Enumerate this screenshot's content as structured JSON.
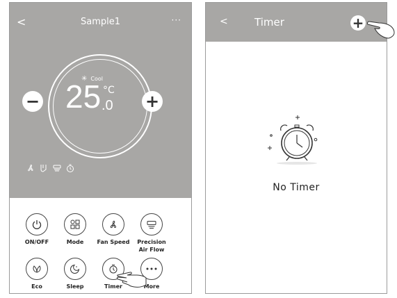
{
  "left_screen": {
    "header": {
      "back_glyph": "<",
      "title": "Sample1",
      "more_glyph": "···"
    },
    "dial": {
      "mode": "Cool",
      "mode_icon": "snowflake-icon",
      "temperature": "25",
      "decimal": ".0",
      "unit": "°C",
      "minus_glyph": "−",
      "plus_glyph": "+"
    },
    "status_icons": [
      "fan-icon",
      "swing-icon",
      "airflow-icon",
      "timer-icon"
    ],
    "controls": [
      {
        "label": "ON/OFF",
        "icon": "power-icon"
      },
      {
        "label": "Mode",
        "icon": "mode-icon"
      },
      {
        "label": "Fan Speed",
        "icon": "fan-icon"
      },
      {
        "label": "Precision Air Flow",
        "icon": "airflow-icon"
      },
      {
        "label": "Eco",
        "icon": "eco-leaf-icon"
      },
      {
        "label": "Sleep",
        "icon": "sleep-icon"
      },
      {
        "label": "Timer",
        "icon": "timer-icon"
      },
      {
        "label": "More",
        "icon": "more-dots-icon"
      }
    ]
  },
  "right_screen": {
    "header": {
      "back_glyph": "<",
      "title": "Timer",
      "add_glyph": "+"
    },
    "empty_state": {
      "icon": "alarm-clock-icon",
      "text": "No Timer"
    }
  },
  "colors": {
    "header_gray": "#a8a7a5",
    "foreground": "#ffffff",
    "text_dark": "#222222"
  }
}
